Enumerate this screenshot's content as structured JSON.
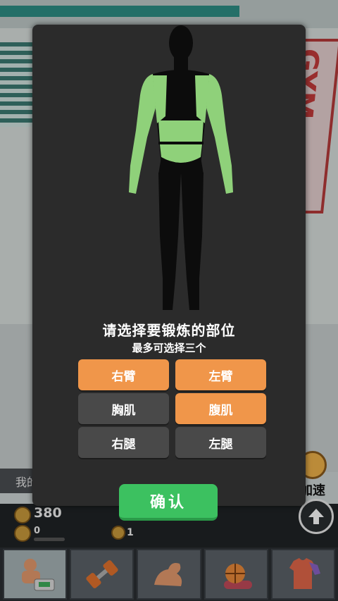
{
  "modal": {
    "title": "请选择要锻炼的部位",
    "subtitle": "最多可选择三个",
    "options": [
      {
        "label": "右臂",
        "selected": true
      },
      {
        "label": "左臂",
        "selected": true
      },
      {
        "label": "胸肌",
        "selected": false
      },
      {
        "label": "腹肌",
        "selected": true
      },
      {
        "label": "右腿",
        "selected": false
      },
      {
        "label": "左腿",
        "selected": false
      }
    ],
    "confirm_label": "确认"
  },
  "background": {
    "sign_text": "GYM",
    "left_panel_text": "我的",
    "speed_label": "加速",
    "coins": "380",
    "xp": "0",
    "xp_fraction": 0.0,
    "tickets": "1"
  },
  "toolbar": {
    "items": [
      {
        "icon": "bodybuilder-scale-icon",
        "active": true
      },
      {
        "icon": "dumbbell-icon",
        "active": false
      },
      {
        "icon": "flexed-arm-icon",
        "active": false
      },
      {
        "icon": "basketball-mat-icon",
        "active": false
      },
      {
        "icon": "jersey-icon",
        "active": false
      }
    ]
  },
  "colors": {
    "highlight": "#8fd17a",
    "selected": "#f0964a",
    "unselected": "#494949",
    "confirm": "#3cc160"
  }
}
